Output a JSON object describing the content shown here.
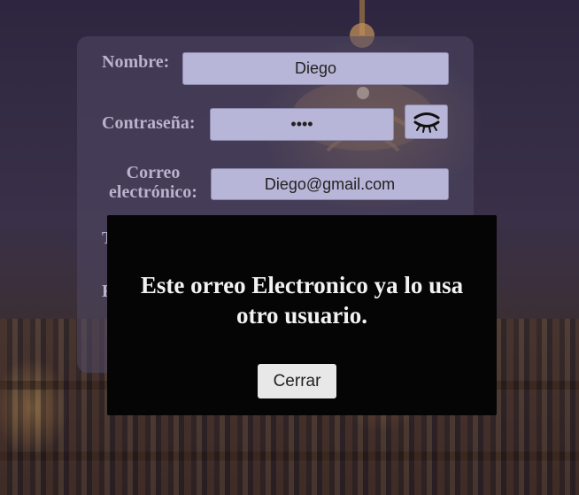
{
  "form": {
    "name_label": "Nombre:",
    "name_value": "Diego",
    "password_label": "Contraseña:",
    "password_value": "••••",
    "email_label_line1": "Correo",
    "email_label_line2": "electrónico:",
    "email_value": "Diego@gmail.com",
    "partial_label_1": "T",
    "partial_label_2": "F"
  },
  "icons": {
    "password_toggle": "closed-eye-icon"
  },
  "modal": {
    "message": "Este orreo Electronico ya lo usa otro usuario.",
    "close_label": "Cerrar"
  },
  "colors": {
    "field_bg": "#b7b5d8",
    "label": "#b9b3cc",
    "modal_bg": "#050505"
  }
}
